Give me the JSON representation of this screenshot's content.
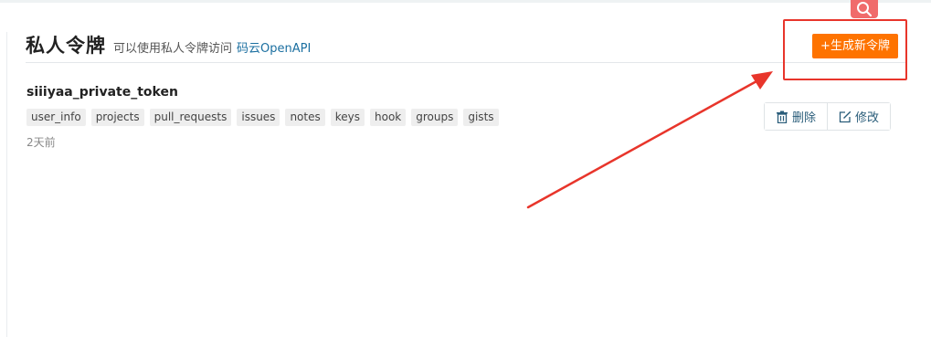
{
  "header": {
    "title": "私人令牌",
    "subtitle": "可以使用私人令牌访问",
    "link_text": "码云OpenAPI"
  },
  "toolbar": {
    "generate_label": "+生成新令牌"
  },
  "token": {
    "name": "siiiyaa_private_token",
    "scopes": [
      "user_info",
      "projects",
      "pull_requests",
      "issues",
      "notes",
      "keys",
      "hook",
      "groups",
      "gists"
    ],
    "created": "2天前",
    "delete_label": "删除",
    "edit_label": "修改"
  },
  "colors": {
    "primary_orange": "#fe7300",
    "annotation_red": "#e8352b",
    "link_blue": "#1b6fa0"
  },
  "icons": {
    "search": "search-icon",
    "delete": "trash-icon",
    "edit": "edit-icon"
  }
}
